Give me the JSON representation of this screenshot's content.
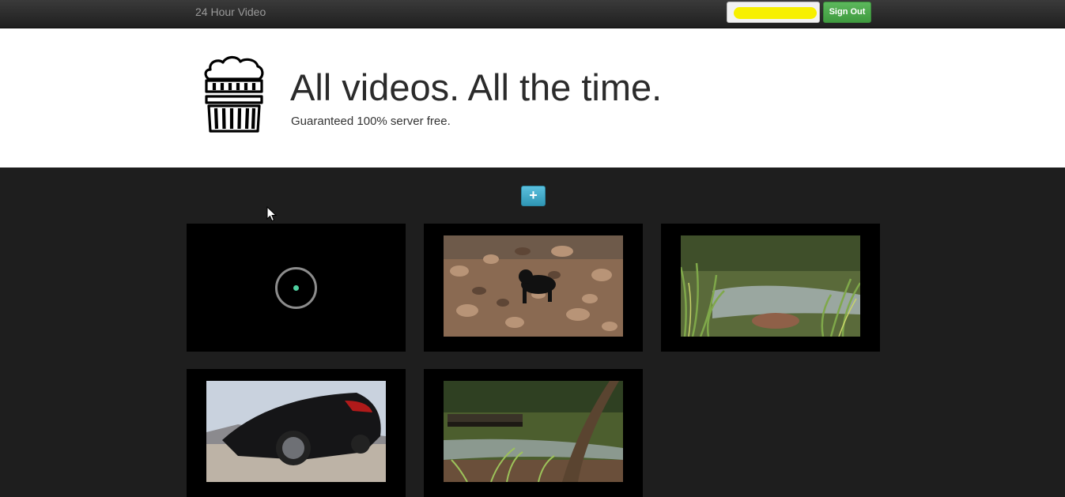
{
  "navbar": {
    "brand": "24 Hour Video",
    "signout_label": "Sign Out"
  },
  "hero": {
    "title": "All videos. All the time.",
    "subtitle": "Guaranteed 100% server free."
  },
  "toolbar": {
    "add_label": "+"
  },
  "videos": [
    {
      "state": "loading"
    },
    {
      "subject": "black dog on rocky creek bed"
    },
    {
      "subject": "grassy creek with flowing water"
    },
    {
      "subject": "black convertible sports car"
    },
    {
      "subject": "creek with wooden bridge and trees"
    }
  ],
  "colors": {
    "navbar": "#2b2b2b",
    "signout": "#4cae4c",
    "add_button": "#49afcd",
    "background": "#1e1e1e",
    "spinner_dot": "#4fd0a0"
  }
}
